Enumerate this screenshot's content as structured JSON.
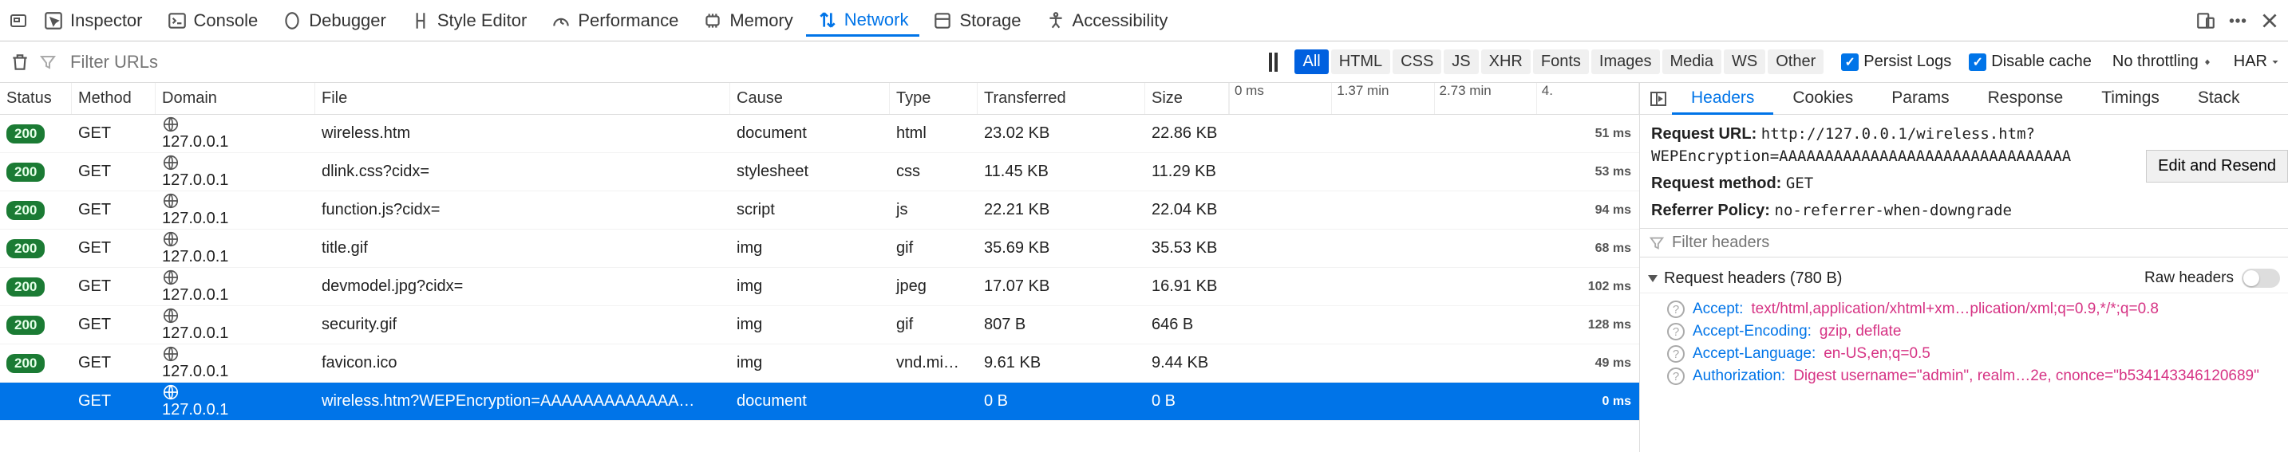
{
  "toolbar": {
    "inspector": "Inspector",
    "console": "Console",
    "debugger": "Debugger",
    "style_editor": "Style Editor",
    "performance": "Performance",
    "memory": "Memory",
    "network": "Network",
    "storage": "Storage",
    "accessibility": "Accessibility"
  },
  "subbar": {
    "filter_placeholder": "Filter URLs",
    "chips": [
      "All",
      "HTML",
      "CSS",
      "JS",
      "XHR",
      "Fonts",
      "Images",
      "Media",
      "WS",
      "Other"
    ],
    "persist": "Persist Logs",
    "disable_cache": "Disable cache",
    "throttling": "No throttling",
    "har": "HAR"
  },
  "columns": {
    "status": "Status",
    "method": "Method",
    "domain": "Domain",
    "file": "File",
    "cause": "Cause",
    "type": "Type",
    "transferred": "Transferred",
    "size": "Size"
  },
  "waterfall_ticks": [
    "0 ms",
    "1.37 min",
    "2.73 min",
    "4."
  ],
  "rows": [
    {
      "status": "200",
      "method": "GET",
      "domain": "127.0.0.1",
      "file": "wireless.htm",
      "cause": "document",
      "type": "html",
      "transferred": "23.02 KB",
      "size": "22.86 KB",
      "time": "51 ms"
    },
    {
      "status": "200",
      "method": "GET",
      "domain": "127.0.0.1",
      "file": "dlink.css?cidx=",
      "cause": "stylesheet",
      "type": "css",
      "transferred": "11.45 KB",
      "size": "11.29 KB",
      "time": "53 ms"
    },
    {
      "status": "200",
      "method": "GET",
      "domain": "127.0.0.1",
      "file": "function.js?cidx=",
      "cause": "script",
      "type": "js",
      "transferred": "22.21 KB",
      "size": "22.04 KB",
      "time": "94 ms"
    },
    {
      "status": "200",
      "method": "GET",
      "domain": "127.0.0.1",
      "file": "title.gif",
      "cause": "img",
      "type": "gif",
      "transferred": "35.69 KB",
      "size": "35.53 KB",
      "time": "68 ms"
    },
    {
      "status": "200",
      "method": "GET",
      "domain": "127.0.0.1",
      "file": "devmodel.jpg?cidx=",
      "cause": "img",
      "type": "jpeg",
      "transferred": "17.07 KB",
      "size": "16.91 KB",
      "time": "102 ms"
    },
    {
      "status": "200",
      "method": "GET",
      "domain": "127.0.0.1",
      "file": "security.gif",
      "cause": "img",
      "type": "gif",
      "transferred": "807 B",
      "size": "646 B",
      "time": "128 ms"
    },
    {
      "status": "200",
      "method": "GET",
      "domain": "127.0.0.1",
      "file": "favicon.ico",
      "cause": "img",
      "type": "vnd.mi…",
      "transferred": "9.61 KB",
      "size": "9.44 KB",
      "time": "49 ms"
    },
    {
      "status": "",
      "method": "GET",
      "domain": "127.0.0.1",
      "file": "wireless.htm?WEPEncryption=AAAAAAAAAAAAA…",
      "cause": "document",
      "type": "",
      "transferred": "0 B",
      "size": "0 B",
      "time": "0 ms",
      "selected": true
    }
  ],
  "detail_tabs": [
    "Headers",
    "Cookies",
    "Params",
    "Response",
    "Timings",
    "Stack"
  ],
  "details": {
    "req_url_label": "Request URL:",
    "req_url": "http://127.0.0.1/wireless.htm?WEPEncryption=AAAAAAAAAAAAAAAAAAAAAAAAAAAAAAAA",
    "req_method_label": "Request method:",
    "req_method": "GET",
    "ref_policy_label": "Referrer Policy:",
    "ref_policy": "no-referrer-when-downgrade",
    "edit_resend": "Edit and Resend",
    "filter_headers_placeholder": "Filter headers",
    "req_headers_label": "Request headers (780 B)",
    "raw_headers": "Raw headers",
    "headers": [
      {
        "name": "Accept",
        "value": "text/html,application/xhtml+xm…plication/xml;q=0.9,*/*;q=0.8"
      },
      {
        "name": "Accept-Encoding",
        "value": "gzip, deflate"
      },
      {
        "name": "Accept-Language",
        "value": "en-US,en;q=0.5"
      },
      {
        "name": "Authorization",
        "value": "Digest username=\"admin\", realm…2e, cnonce=\"b534143346120689\""
      }
    ]
  }
}
